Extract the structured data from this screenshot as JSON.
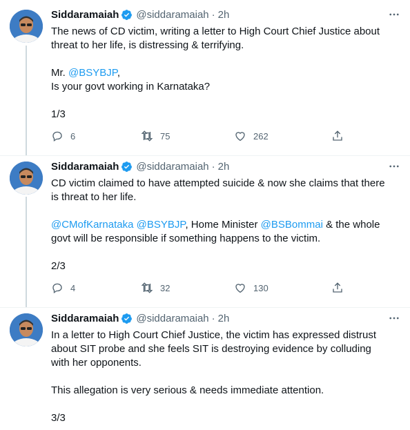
{
  "icons": {
    "verified": "verified-badge-icon",
    "more": "more-options-icon",
    "reply": "reply-icon",
    "retweet": "retweet-icon",
    "like": "like-icon",
    "share": "share-icon"
  },
  "colors": {
    "accent": "#1d9bf0",
    "text": "#0f1419",
    "muted": "#536471",
    "thread_line": "#cfd9de"
  },
  "tweets": [
    {
      "name": "Siddaramaiah",
      "handle": "@siddaramaiah",
      "dot": "·",
      "time": "2h",
      "lines": [
        [
          "The news of CD victim, writing a letter to High Court Chief Justice about"
        ],
        [
          "threat to her life, is distressing & terrifying."
        ]
      ],
      "p2a": "Mr. ",
      "p2b": "@BSYBJP",
      "p2c": ",",
      "p2d": "Is your govt working in Karnataka?",
      "p3": "1/3",
      "replies": "6",
      "retweets": "75",
      "likes": "262"
    },
    {
      "name": "Siddaramaiah",
      "handle": "@siddaramaiah",
      "dot": "·",
      "time": "2h",
      "p1a": "CD victim claimed to have attempted suicide & now she claims that there",
      "p1b": "is threat to her life.",
      "m1": "@CMofKarnataka",
      "m2": "@BSYBJP",
      "t1": ", Home Minister ",
      "m3": "@BSBommai",
      "t2": " & the whole",
      "t3": "govt will be responsible if something happens to the victim.",
      "p3": "2/3",
      "replies": "4",
      "retweets": "32",
      "likes": "130"
    },
    {
      "name": "Siddaramaiah",
      "handle": "@siddaramaiah",
      "dot": "·",
      "time": "2h",
      "p1a": "In a letter to High Court Chief Justice, the victim has expressed distrust",
      "p1b": "about SIT probe and she feels SIT is destroying evidence by colluding",
      "p1c": "with her opponents.",
      "p2": "This allegation is very serious & needs immediate attention.",
      "p3": "3/3"
    }
  ]
}
